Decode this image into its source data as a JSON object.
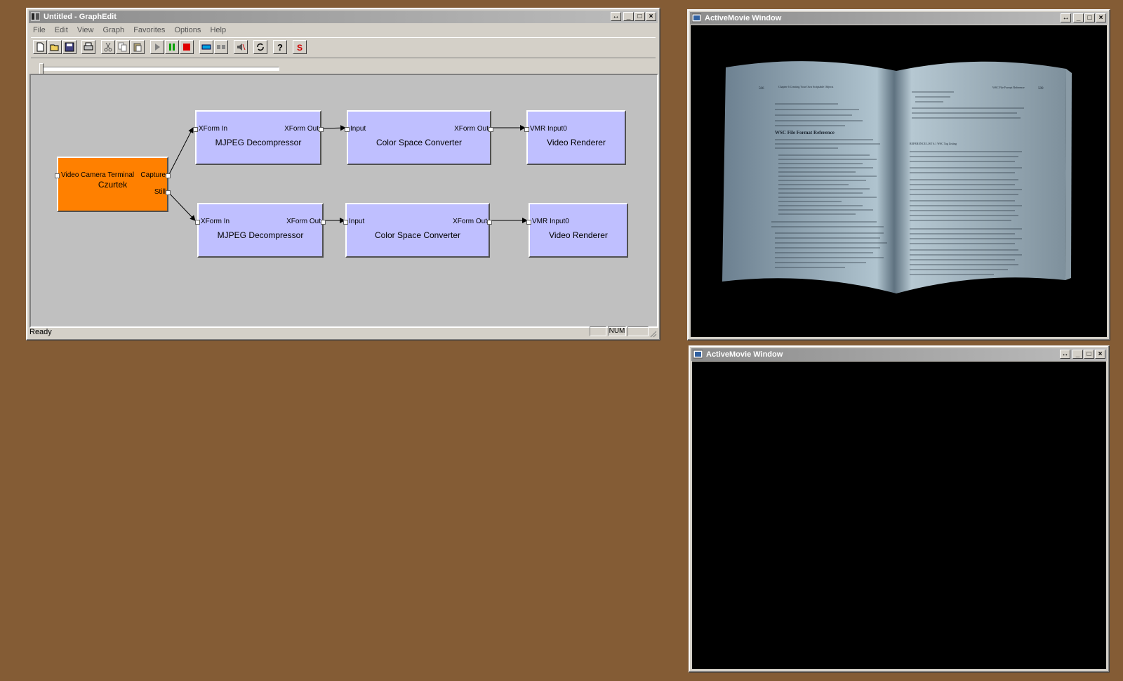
{
  "graphedit": {
    "title": "Untitled - GraphEdit",
    "menu": [
      "File",
      "Edit",
      "View",
      "Graph",
      "Favorites",
      "Options",
      "Help"
    ],
    "filters": {
      "camera": {
        "name": "Czurtek",
        "pin_in": "Video Camera Terminal",
        "pin_capture": "Capture",
        "pin_still": "Still"
      },
      "mjpeg1": {
        "name": "MJPEG Decompressor",
        "pin_in": "XForm In",
        "pin_out": "XForm Out"
      },
      "csc1": {
        "name": "Color Space Converter",
        "pin_in": "Input",
        "pin_out": "XForm Out"
      },
      "vr1": {
        "name": "Video Renderer",
        "pin_in": "VMR Input0"
      },
      "mjpeg2": {
        "name": "MJPEG Decompressor",
        "pin_in": "XForm In",
        "pin_out": "XForm Out"
      },
      "csc2": {
        "name": "Color Space Converter",
        "pin_in": "Input",
        "pin_out": "XForm Out"
      },
      "vr2": {
        "name": "Video Renderer",
        "pin_in": "VMR Input0"
      }
    },
    "status": {
      "text": "Ready",
      "num": "NUM"
    },
    "colors": {
      "source_filter": "#ff8000",
      "transform_filter": "#bfbfff",
      "canvas": "#c0c0c0"
    }
  },
  "activemovie_top": {
    "title": "ActiveMovie Window"
  },
  "activemovie_bottom": {
    "title": "ActiveMovie Window"
  },
  "book": {
    "left_header_page": "506",
    "left_header_chapter": "Chapter 6   Creating Your Own Scriptable Objects",
    "right_header": "WSC File Format Reference",
    "right_header_page": "509",
    "heading": "WSC File Format Reference",
    "listing": "REFERENCE LIST 6.1   WSC Tag Listing"
  }
}
